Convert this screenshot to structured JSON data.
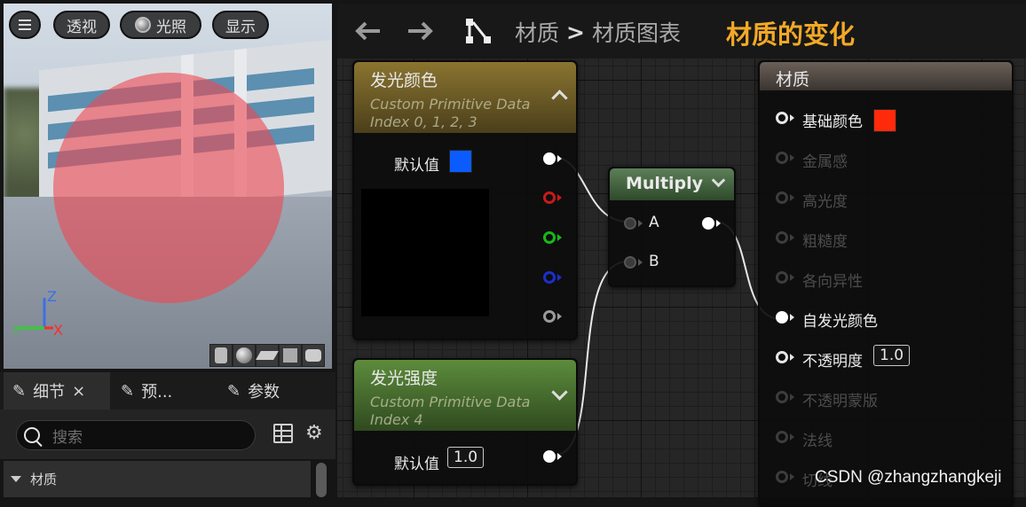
{
  "viewport": {
    "buttons": {
      "menu_icon": "menu-icon",
      "perspective": "透视",
      "lighting": "光照",
      "show": "显示"
    },
    "axes": {
      "z": "Z",
      "y": "Y",
      "x": "X"
    },
    "colors": {
      "sphere": "#ee4852",
      "z_axis": "#3d6fe6",
      "y_axis": "#2fd02f",
      "x_axis": "#ff2b2b"
    }
  },
  "details_panel": {
    "tabs": [
      {
        "label": "细节",
        "close": "×",
        "icon": "pencil-icon"
      },
      {
        "label": "预...",
        "icon": "pencil-icon"
      },
      {
        "label": "参数",
        "icon": "pencil-icon"
      }
    ],
    "search_placeholder": "搜索",
    "section": "材质"
  },
  "toolbar": {
    "breadcrumb": [
      "材质",
      "材质图表"
    ],
    "separator": ">",
    "title": "材质的变化",
    "colors": {
      "title": "#f3a926"
    }
  },
  "nodes": {
    "emissive_color": {
      "title": "发光颜色",
      "subtitle_1": "Custom Primitive Data",
      "subtitle_2": "Index 0, 1, 2, 3",
      "default_label": "默认值",
      "default_color": "#0b5cff",
      "header_color": "#7d6a2c"
    },
    "emissive_strength": {
      "title": "发光强度",
      "subtitle_1": "Custom Primitive Data",
      "subtitle_2": "Index 4",
      "default_label": "默认值",
      "default_value": "1.0",
      "header_color": "#4f7b33"
    },
    "multiply": {
      "title": "Multiply",
      "pin_a": "A",
      "pin_b": "B",
      "header_color": "#4c6e4a"
    },
    "material": {
      "title": "材质",
      "pins": [
        {
          "label": "基础颜色",
          "active": true,
          "swatch": "#ff2a0a"
        },
        {
          "label": "金属感",
          "active": false
        },
        {
          "label": "高光度",
          "active": false
        },
        {
          "label": "粗糙度",
          "active": false
        },
        {
          "label": "各向异性",
          "active": false
        },
        {
          "label": "自发光颜色",
          "active": true,
          "connected": true
        },
        {
          "label": "不透明度",
          "active": true,
          "value": "1.0"
        },
        {
          "label": "不透明蒙版",
          "active": false
        },
        {
          "label": "法线",
          "active": false
        },
        {
          "label": "切线",
          "active": false
        }
      ],
      "header_color": "#5a524c"
    }
  },
  "watermark": "CSDN @zhangzhangkeji"
}
